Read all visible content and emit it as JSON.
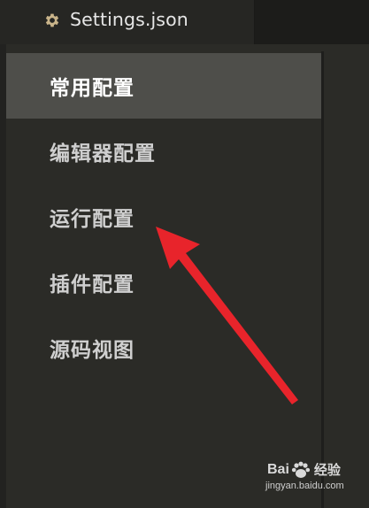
{
  "tab": {
    "icon": "gear-icon",
    "title": "Settings.json"
  },
  "sidebar": {
    "items": [
      {
        "label": "常用配置",
        "active": true
      },
      {
        "label": "编辑器配置",
        "active": false
      },
      {
        "label": "运行配置",
        "active": false
      },
      {
        "label": "插件配置",
        "active": false
      },
      {
        "label": "源码视图",
        "active": false
      }
    ]
  },
  "annotation": {
    "arrow_color": "#e8242b",
    "points_to": "运行配置"
  },
  "watermark": {
    "brand_a": "Bai",
    "brand_b": "经验",
    "url": "jingyan.baidu.com"
  },
  "colors": {
    "background": "#2b2b27",
    "active_item": "#4e4e4a",
    "text": "#cfcfcf"
  }
}
